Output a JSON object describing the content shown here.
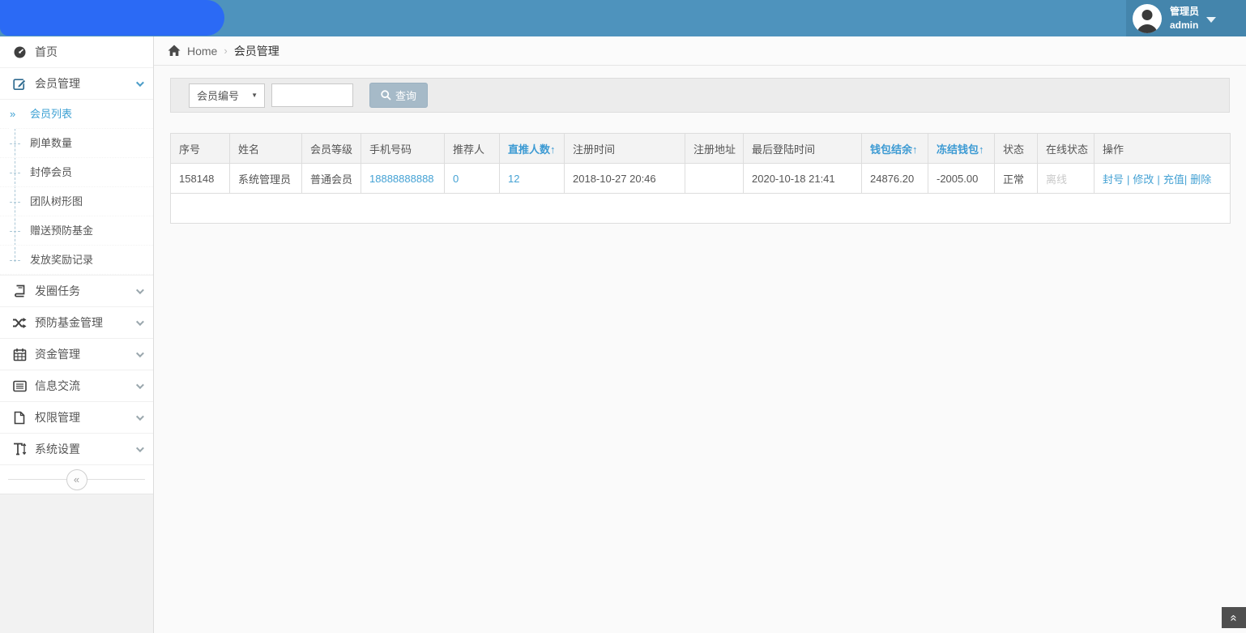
{
  "colors": {
    "topbar": "#4e93bd",
    "logo_blob": "#2b6af5",
    "user_block": "#4485ac",
    "link_blue": "#45a2d4",
    "sort_header_blue": "#3c9ad3",
    "search_button": "#a6bac8"
  },
  "topbar": {
    "user": {
      "role": "管理员",
      "name": "admin"
    }
  },
  "sidebar": {
    "items": [
      {
        "label": "首页",
        "icon": "dashboard"
      },
      {
        "label": "会员管理",
        "icon": "edit",
        "expanded": true,
        "children": [
          {
            "label": "会员列表",
            "active": true
          },
          {
            "label": "刷单数量"
          },
          {
            "label": "封停会员"
          },
          {
            "label": "团队树形图"
          },
          {
            "label": "赠送预防基金"
          },
          {
            "label": "发放奖励记录"
          }
        ]
      },
      {
        "label": "发圈任务",
        "icon": "book"
      },
      {
        "label": "预防基金管理",
        "icon": "shuffle"
      },
      {
        "label": "资金管理",
        "icon": "calendar"
      },
      {
        "label": "信息交流",
        "icon": "list"
      },
      {
        "label": "权限管理",
        "icon": "file"
      },
      {
        "label": "系统设置",
        "icon": "text-height"
      }
    ],
    "collapse_glyph": "«"
  },
  "breadcrumb": {
    "home": "Home",
    "separator": "›",
    "current": "会员管理"
  },
  "search": {
    "filter_selected": "会员编号",
    "select_caret": "▼",
    "input_value": "",
    "button_label": "查询"
  },
  "table": {
    "columns": [
      {
        "label": "序号",
        "sortable": false
      },
      {
        "label": "姓名",
        "sortable": false
      },
      {
        "label": "会员等级",
        "sortable": false
      },
      {
        "label": "手机号码",
        "sortable": false
      },
      {
        "label": "推荐人",
        "sortable": false
      },
      {
        "label": "直推人数↑",
        "sortable": true
      },
      {
        "label": "注册时间",
        "sortable": false
      },
      {
        "label": "注册地址",
        "sortable": false
      },
      {
        "label": "最后登陆时间",
        "sortable": false
      },
      {
        "label": "钱包结余↑",
        "sortable": true
      },
      {
        "label": "冻结钱包↑",
        "sortable": true
      },
      {
        "label": "状态",
        "sortable": false
      },
      {
        "label": "在线状态",
        "sortable": false
      },
      {
        "label": "操作",
        "sortable": false
      }
    ],
    "action_separator": "|",
    "rows": [
      {
        "seq": "158148",
        "name": "系统管理员",
        "level": "普通会员",
        "phone": "18888888888",
        "referrer": "0",
        "direct_count": "12",
        "register_time": "2018-10-27 20:46",
        "register_address": "",
        "last_login": "2020-10-18 21:41",
        "wallet_balance": "24876.20",
        "frozen_wallet": "-2005.00",
        "status": "正常",
        "online_status": "离线",
        "actions": [
          "封号",
          "修改",
          "充值",
          "删除"
        ]
      }
    ]
  },
  "back_to_top_glyph": "«"
}
